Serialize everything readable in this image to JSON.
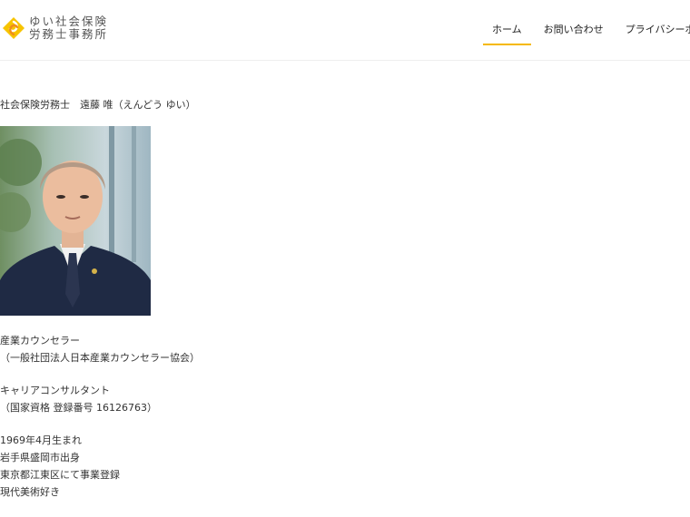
{
  "logo": {
    "line1": "ゆい社会保険",
    "line2": "労務士事務所"
  },
  "nav": {
    "items": [
      "ホーム",
      "お問い合わせ",
      "プライバシーポリシー"
    ],
    "active_index": 0
  },
  "profile": {
    "title": "社会保険労務士　遠藤 唯（えんどう ゆい）",
    "qualifications": [
      [
        "産業カウンセラー",
        "（一般社団法人日本産業カウンセラー協会）"
      ],
      [
        "キャリアコンサルタント",
        "（国家資格 登録番号 16126763）"
      ]
    ],
    "bio": [
      "1969年4月生まれ",
      "岩手県盛岡市出身",
      "東京都江東区にて事業登録",
      "現代美術好き"
    ]
  },
  "colors": {
    "accent": "#f5b800",
    "logo_orange": "#f08c1e",
    "logo_yellow": "#f7c400"
  }
}
